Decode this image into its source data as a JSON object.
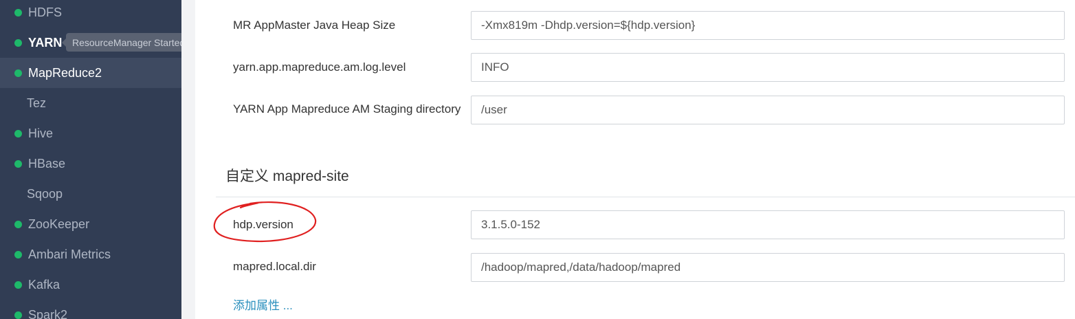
{
  "sidebar": {
    "items": [
      {
        "label": "HDFS",
        "dot": true
      },
      {
        "label": "YARN",
        "dot": true
      },
      {
        "label": "MapReduce2",
        "dot": true
      },
      {
        "label": "Tez",
        "dot": false
      },
      {
        "label": "Hive",
        "dot": true
      },
      {
        "label": "HBase",
        "dot": true
      },
      {
        "label": "Sqoop",
        "dot": false
      },
      {
        "label": "ZooKeeper",
        "dot": true
      },
      {
        "label": "Ambari Metrics",
        "dot": true
      },
      {
        "label": "Kafka",
        "dot": true
      },
      {
        "label": "Spark2",
        "dot": true
      }
    ],
    "tooltip": "ResourceManager Started",
    "status_color": "#1eb96a"
  },
  "config": {
    "rows": [
      {
        "label": "MR AppMaster Java Heap Size",
        "value": "-Xmx819m -Dhdp.version=${hdp.version}"
      },
      {
        "label": "yarn.app.mapreduce.am.log.level",
        "value": "INFO"
      },
      {
        "label": "YARN App Mapreduce AM Staging directory",
        "value": "/user"
      }
    ],
    "custom_section": {
      "title": "自定义 mapred-site",
      "rows": [
        {
          "label": "hdp.version",
          "value": "3.1.5.0-152"
        },
        {
          "label": "mapred.local.dir",
          "value": "/hadoop/mapred,/data/hadoop/mapred"
        }
      ],
      "add_link": "添加属性 ..."
    }
  }
}
